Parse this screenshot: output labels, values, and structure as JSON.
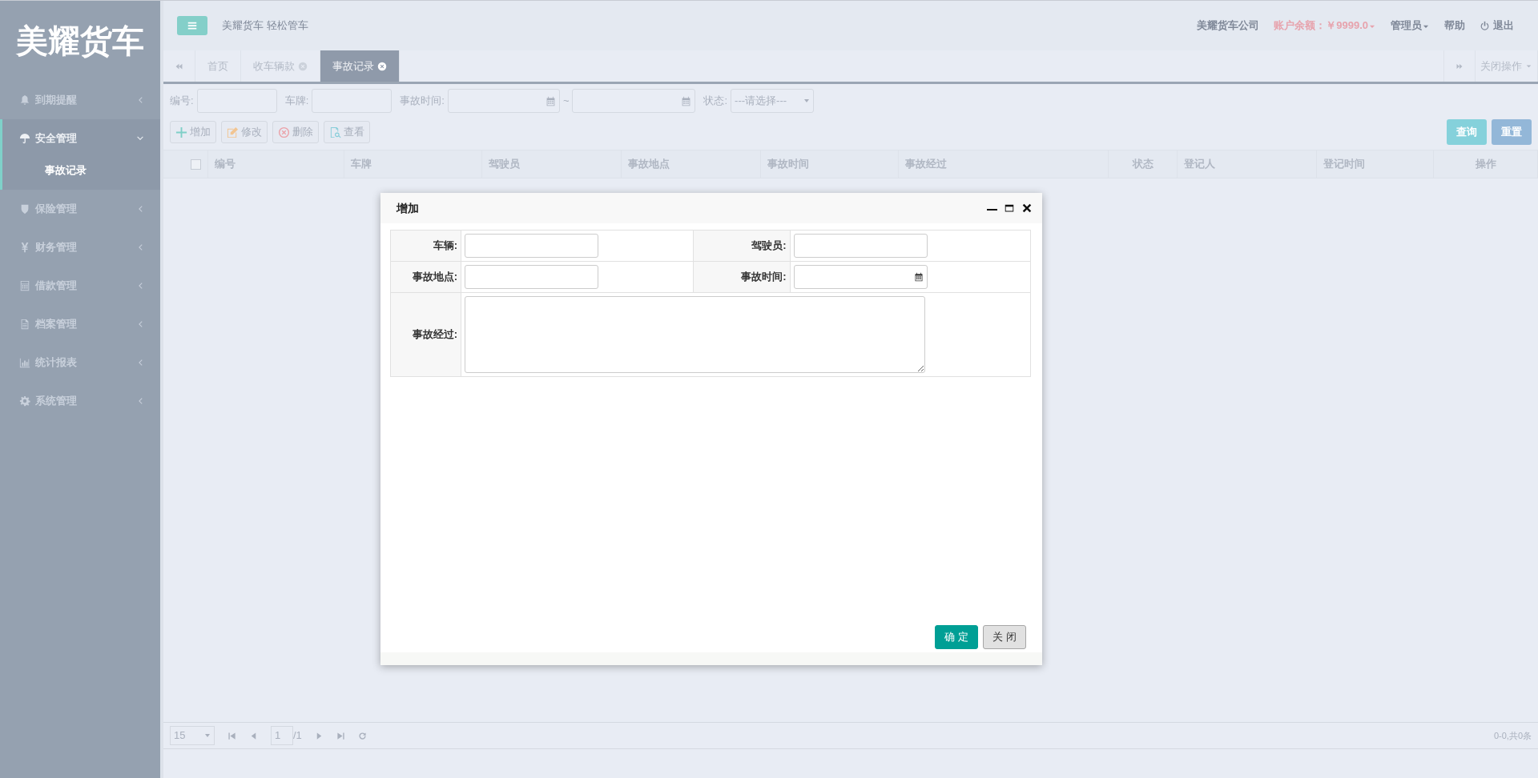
{
  "sidebar": {
    "logo": "美耀货车",
    "items": [
      {
        "label": "到期提醒",
        "expanded": false
      },
      {
        "label": "安全管理",
        "expanded": true,
        "children": [
          {
            "label": "事故记录",
            "selected": true
          }
        ]
      },
      {
        "label": "保险管理",
        "expanded": false
      },
      {
        "label": "财务管理",
        "expanded": false
      },
      {
        "label": "借款管理",
        "expanded": false
      },
      {
        "label": "档案管理",
        "expanded": false
      },
      {
        "label": "统计报表",
        "expanded": false
      },
      {
        "label": "系统管理",
        "expanded": false
      }
    ]
  },
  "header": {
    "slogan": "美耀货车 轻松管车",
    "company": "美耀货车公司",
    "balance": "账户余额：￥9999.0",
    "user": "管理员",
    "help": "帮助",
    "logout": "退出"
  },
  "tabs": [
    {
      "label": "首页",
      "closable": false,
      "selected": false
    },
    {
      "label": "收车辆款",
      "closable": true,
      "selected": false
    },
    {
      "label": "事故记录",
      "closable": true,
      "selected": true
    }
  ],
  "close_ops": "关闭操作",
  "filters": [
    {
      "label": "编号:",
      "kind": "text"
    },
    {
      "label": "车牌:",
      "kind": "text"
    },
    {
      "label": "事故时间:",
      "kind": "daterange",
      "separator": "~"
    },
    {
      "label": "状态:",
      "kind": "select",
      "value": "---请选择---"
    }
  ],
  "toolbar": [
    {
      "label": "增加"
    },
    {
      "label": "修改"
    },
    {
      "label": "删除"
    },
    {
      "label": "查看"
    }
  ],
  "search_buttons": [
    {
      "label": "查询",
      "kind": "search"
    },
    {
      "label": "重置",
      "kind": "reset"
    }
  ],
  "table": {
    "select_all_checked": false,
    "columns": [
      "编号",
      "车牌",
      "驾驶员",
      "事故地点",
      "事故时间",
      "事故经过",
      "状态",
      "登记人",
      "登记时间",
      "操作"
    ]
  },
  "dialog": {
    "title": "增加",
    "fields": [
      {
        "label": "车辆:",
        "kind": "text"
      },
      {
        "label": "驾驶员:",
        "kind": "text"
      },
      {
        "label": "事故地点:",
        "kind": "text"
      },
      {
        "label": "事故时间:",
        "kind": "date"
      },
      {
        "label": "事故经过:",
        "kind": "textarea"
      }
    ],
    "buttons": [
      {
        "label": "确 定",
        "primary": true
      },
      {
        "label": "关 闭",
        "primary": false
      }
    ]
  },
  "pager": {
    "page_size": "15",
    "page": "1",
    "total_pages": "/1",
    "summary": "0-0,共0条"
  }
}
